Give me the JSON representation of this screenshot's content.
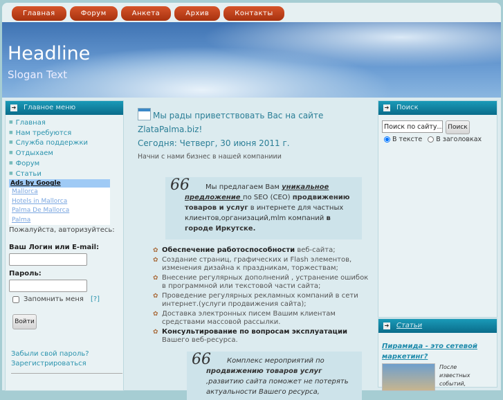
{
  "nav": [
    "Главная",
    "Форум",
    "Анкета",
    "Архив",
    "Контакты"
  ],
  "header": {
    "headline": "Headline",
    "slogan": "Slogan Text"
  },
  "left": {
    "menu_title": "Главное меню",
    "menu": [
      "Главная",
      "Нам требуются",
      "Служба поддержки",
      "Отдыхаем",
      "Форум",
      "Статьи"
    ],
    "ads_title": "Ads by Google",
    "ads": [
      "Mallorca",
      "Hotels in Mallorca",
      "Palma De Mallorca",
      "Palma"
    ],
    "login_prompt": "Пожалуйста, авторизуйтесь:",
    "login_label": "Ваш Логин или E-mail:",
    "password_label": "Пароль:",
    "remember": "Запомнить меня",
    "help": "[?]",
    "login_button": "Войти",
    "forgot": "Забыли свой пароль?",
    "register": "Зарегистрироваться"
  },
  "center": {
    "welcome": "Мы рады приветствовать Вас на сайте ZlataPalma.biz!",
    "date": "Сегодня: Четверг, 30 июня 2011 г.",
    "subtitle": "Начни с нами бизнес в нашей компаниии",
    "quote1": {
      "a": "Мы предлагаем Вам ",
      "b": "уникальное предложение ",
      "c": " по SEO (CEO) ",
      "d": "продвижению товаров и услуг",
      "e": " в интернете для  частных клиентов,организаций,mlm компаний ",
      "f": "в городе Иркутске."
    },
    "list": [
      {
        "b": "Обеспечение работоспособности",
        "t": " веб-сайта;"
      },
      {
        "b": "",
        "t": "Создание  страниц, графических и Flash элементов, изменения дизайна  к праздникам, торжествам;"
      },
      {
        "b": "",
        "t": "Внесение регулярных  дополнений ,  устранение ошибок в программной или  текстовой части сайта;"
      },
      {
        "b": "",
        "t": "Проведение регулярных рекламных компаний в сети интернет.(услуги продвижения сайта);"
      },
      {
        "b": "",
        "t": "Доставка электронных писем Вашим клиентам средствами массовой рассылки."
      },
      {
        "b": "Консультирование  по вопросам эксплуатации",
        "t": " Вашего веб-ресурса."
      }
    ],
    "quote2": {
      "a": "Комплекс мероприятий по ",
      "b": "продвижению товаров услуг",
      "c": " ,развитию сайта поможет не потерять актуальности Вашего ресурса, удерживать внимание и интерес пользователей, клиентов"
    }
  },
  "right": {
    "search_title": "Поиск",
    "search_value": "Поиск по сайту...",
    "search_button": "Поиск",
    "opt_text": "В тексте",
    "opt_titles": "В заголовках",
    "articles_title": "Статьи",
    "article_link": "Пирамида - это сетевой маркетинг?",
    "article_excerpt": "После известных событий,"
  }
}
